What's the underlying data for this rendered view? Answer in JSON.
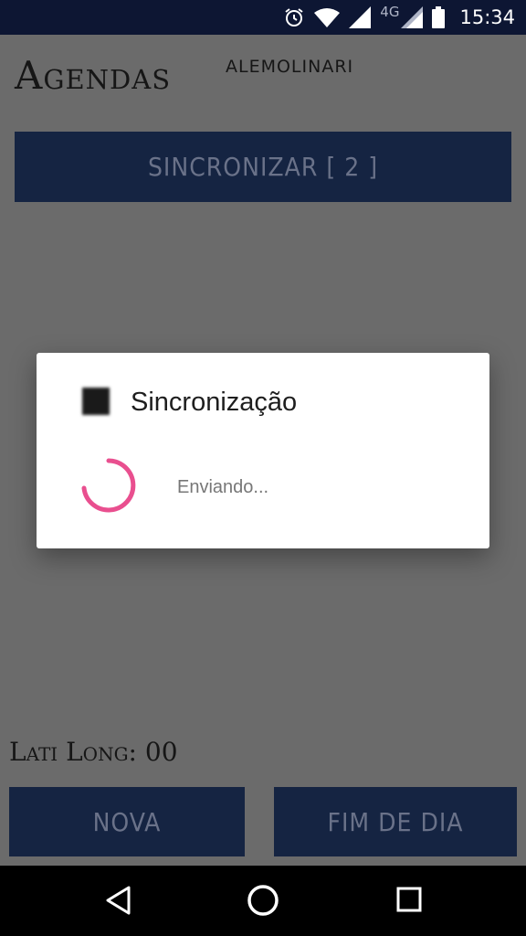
{
  "status_bar": {
    "network": "4G",
    "time": "15:34",
    "icons": [
      "alarm-icon",
      "wifi-icon",
      "signal-icon",
      "signal-icon",
      "battery-icon"
    ]
  },
  "header": {
    "title": "Agendas",
    "username": "ALEMOLINARI"
  },
  "buttons": {
    "sync": "SINCRONIZAR [ 2 ]",
    "nova": "NOVA",
    "fim_de_dia": "FIM DE DIA"
  },
  "location": {
    "text": "Lati Long: 00"
  },
  "dialog": {
    "title": "Sincronização",
    "message": "Enviando...",
    "icon": "app-icon",
    "spinner_color": "#e94f8f"
  },
  "nav": [
    "back-icon",
    "home-icon",
    "recents-icon"
  ],
  "colors": {
    "status_bar": "#0d1633",
    "button_bg": "#152442",
    "overlay": "#6b6b6b"
  }
}
